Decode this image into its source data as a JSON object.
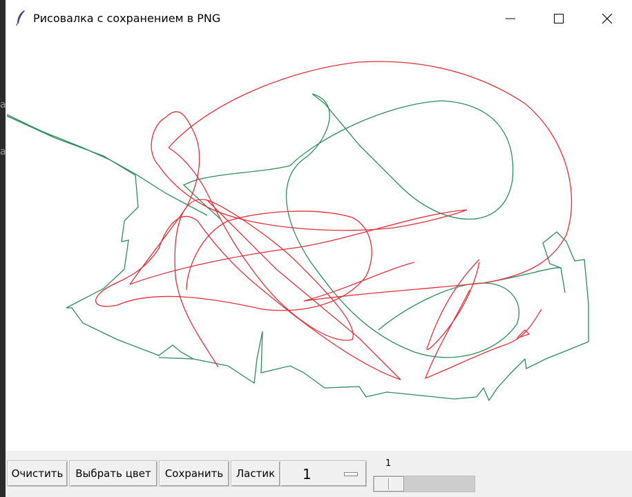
{
  "window": {
    "title": "Рисовалка с сохранением в PNG",
    "icon": "feather-icon",
    "controls": [
      "minimize-icon",
      "maximize-icon",
      "close-icon"
    ]
  },
  "background_fragments": [
    "a",
    "a"
  ],
  "canvas": {
    "background": "#ffffff",
    "stroke_colors": {
      "green": "#2e8b57",
      "red": "#e0303a"
    }
  },
  "toolbar": {
    "clear_label": "Очистить",
    "choose_color_label": "Выбрать цвет",
    "save_label": "Сохранить",
    "eraser_label": "Ластик",
    "brush_size_selected": "1",
    "scale_value": "1"
  }
}
